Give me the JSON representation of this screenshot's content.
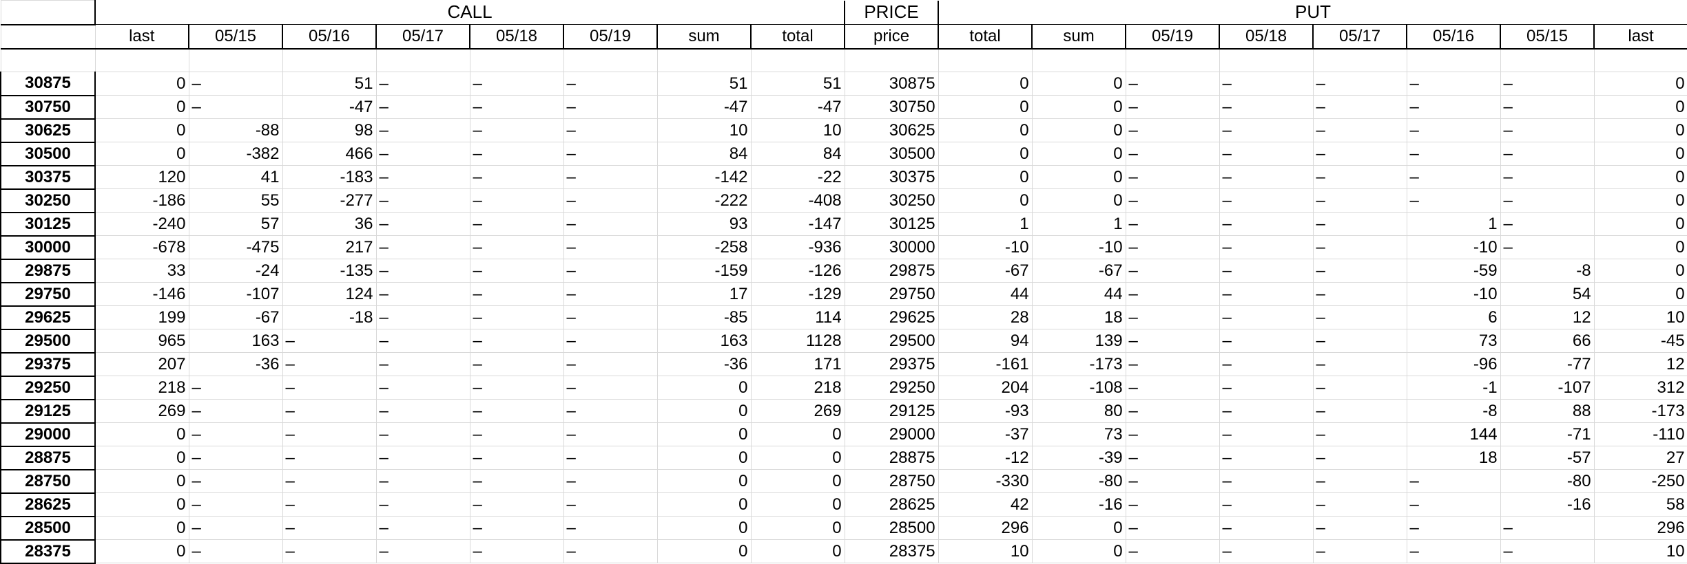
{
  "groups": {
    "call": "CALL",
    "price": "PRICE",
    "put": "PUT"
  },
  "columns": [
    "last",
    "05/15",
    "05/16",
    "05/17",
    "05/18",
    "05/19",
    "sum",
    "total",
    "price",
    "total",
    "sum",
    "05/19",
    "05/18",
    "05/17",
    "05/16",
    "05/15",
    "last"
  ],
  "rows": [
    {
      "strike": "30875",
      "cells": [
        "0",
        "–",
        "51",
        "–",
        "–",
        "–",
        "51",
        "51",
        "30875",
        "0",
        "0",
        "–",
        "–",
        "–",
        "–",
        "–",
        "0"
      ]
    },
    {
      "strike": "30750",
      "cells": [
        "0",
        "–",
        "-47",
        "–",
        "–",
        "–",
        "-47",
        "-47",
        "30750",
        "0",
        "0",
        "–",
        "–",
        "–",
        "–",
        "–",
        "0"
      ]
    },
    {
      "strike": "30625",
      "cells": [
        "0",
        "-88",
        "98",
        "–",
        "–",
        "–",
        "10",
        "10",
        "30625",
        "0",
        "0",
        "–",
        "–",
        "–",
        "–",
        "–",
        "0"
      ]
    },
    {
      "strike": "30500",
      "cells": [
        "0",
        "-382",
        "466",
        "–",
        "–",
        "–",
        "84",
        "84",
        "30500",
        "0",
        "0",
        "–",
        "–",
        "–",
        "–",
        "–",
        "0"
      ]
    },
    {
      "strike": "30375",
      "cells": [
        "120",
        "41",
        "-183",
        "–",
        "–",
        "–",
        "-142",
        "-22",
        "30375",
        "0",
        "0",
        "–",
        "–",
        "–",
        "–",
        "–",
        "0"
      ]
    },
    {
      "strike": "30250",
      "cells": [
        "-186",
        "55",
        "-277",
        "–",
        "–",
        "–",
        "-222",
        "-408",
        "30250",
        "0",
        "0",
        "–",
        "–",
        "–",
        "–",
        "–",
        "0"
      ]
    },
    {
      "strike": "30125",
      "cells": [
        "-240",
        "57",
        "36",
        "–",
        "–",
        "–",
        "93",
        "-147",
        "30125",
        "1",
        "1",
        "–",
        "–",
        "–",
        "1",
        "–",
        "0"
      ]
    },
    {
      "strike": "30000",
      "cells": [
        "-678",
        "-475",
        "217",
        "–",
        "–",
        "–",
        "-258",
        "-936",
        "30000",
        "-10",
        "-10",
        "–",
        "–",
        "–",
        "-10",
        "–",
        "0"
      ]
    },
    {
      "strike": "29875",
      "cells": [
        "33",
        "-24",
        "-135",
        "–",
        "–",
        "–",
        "-159",
        "-126",
        "29875",
        "-67",
        "-67",
        "–",
        "–",
        "–",
        "-59",
        "-8",
        "0"
      ]
    },
    {
      "strike": "29750",
      "cells": [
        "-146",
        "-107",
        "124",
        "–",
        "–",
        "–",
        "17",
        "-129",
        "29750",
        "44",
        "44",
        "–",
        "–",
        "–",
        "-10",
        "54",
        "0"
      ]
    },
    {
      "strike": "29625",
      "cells": [
        "199",
        "-67",
        "-18",
        "–",
        "–",
        "–",
        "-85",
        "114",
        "29625",
        "28",
        "18",
        "–",
        "–",
        "–",
        "6",
        "12",
        "10"
      ]
    },
    {
      "strike": "29500",
      "cells": [
        "965",
        "163",
        "–",
        "–",
        "–",
        "–",
        "163",
        "1128",
        "29500",
        "94",
        "139",
        "–",
        "–",
        "–",
        "73",
        "66",
        "-45"
      ]
    },
    {
      "strike": "29375",
      "cells": [
        "207",
        "-36",
        "–",
        "–",
        "–",
        "–",
        "-36",
        "171",
        "29375",
        "-161",
        "-173",
        "–",
        "–",
        "–",
        "-96",
        "-77",
        "12"
      ]
    },
    {
      "strike": "29250",
      "cells": [
        "218",
        "–",
        "–",
        "–",
        "–",
        "–",
        "0",
        "218",
        "29250",
        "204",
        "-108",
        "–",
        "–",
        "–",
        "-1",
        "-107",
        "312"
      ]
    },
    {
      "strike": "29125",
      "cells": [
        "269",
        "–",
        "–",
        "–",
        "–",
        "–",
        "0",
        "269",
        "29125",
        "-93",
        "80",
        "–",
        "–",
        "–",
        "-8",
        "88",
        "-173"
      ]
    },
    {
      "strike": "29000",
      "cells": [
        "0",
        "–",
        "–",
        "–",
        "–",
        "–",
        "0",
        "0",
        "29000",
        "-37",
        "73",
        "–",
        "–",
        "–",
        "144",
        "-71",
        "-110"
      ]
    },
    {
      "strike": "28875",
      "cells": [
        "0",
        "–",
        "–",
        "–",
        "–",
        "–",
        "0",
        "0",
        "28875",
        "-12",
        "-39",
        "–",
        "–",
        "–",
        "18",
        "-57",
        "27"
      ]
    },
    {
      "strike": "28750",
      "cells": [
        "0",
        "–",
        "–",
        "–",
        "–",
        "–",
        "0",
        "0",
        "28750",
        "-330",
        "-80",
        "–",
        "–",
        "–",
        "–",
        "-80",
        "-250"
      ]
    },
    {
      "strike": "28625",
      "cells": [
        "0",
        "–",
        "–",
        "–",
        "–",
        "–",
        "0",
        "0",
        "28625",
        "42",
        "-16",
        "–",
        "–",
        "–",
        "–",
        "-16",
        "58"
      ]
    },
    {
      "strike": "28500",
      "cells": [
        "0",
        "–",
        "–",
        "–",
        "–",
        "–",
        "0",
        "0",
        "28500",
        "296",
        "0",
        "–",
        "–",
        "–",
        "–",
        "–",
        "296"
      ]
    },
    {
      "strike": "28375",
      "cells": [
        "0",
        "–",
        "–",
        "–",
        "–",
        "–",
        "0",
        "0",
        "28375",
        "10",
        "0",
        "–",
        "–",
        "–",
        "–",
        "–",
        "10"
      ]
    }
  ]
}
